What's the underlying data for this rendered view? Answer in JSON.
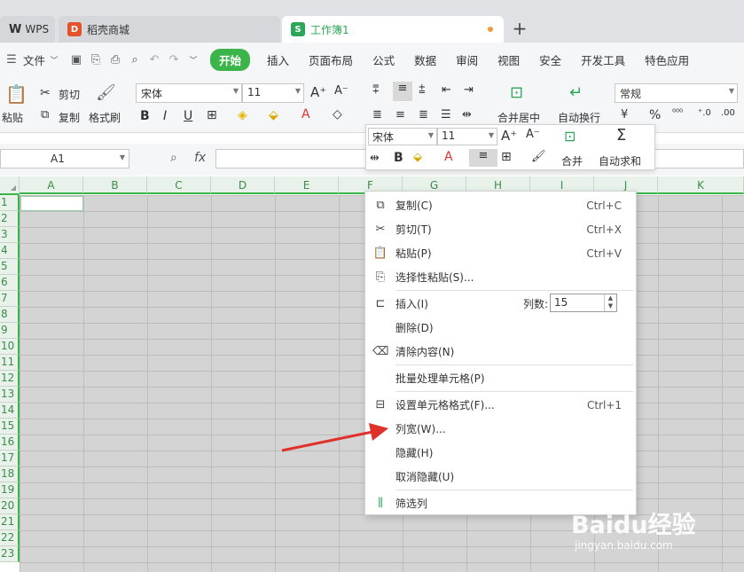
{
  "titlebar": {
    "wps_label": "WPS",
    "tab_shop": "稻壳商城",
    "tab_workbook": "工作簿1",
    "new_tab": "+"
  },
  "menu": {
    "file": "文件",
    "start": "开始",
    "insert": "插入",
    "page_layout": "页面布局",
    "formula": "公式",
    "data": "数据",
    "review": "审阅",
    "view": "视图",
    "security": "安全",
    "dev_tools": "开发工具",
    "special": "特色应用"
  },
  "ribbon": {
    "cut": "剪切",
    "copy": "复制",
    "paste": "粘贴",
    "format_painter": "格式刷",
    "font_name": "宋体",
    "font_size": "11",
    "merge_center": "合并居中",
    "wrap_text": "自动换行",
    "number_format": "常规"
  },
  "formula_bar": {
    "name_box": "A1",
    "fx": "fx"
  },
  "mini_toolbar": {
    "font_name": "宋体",
    "font_size": "11",
    "merge": "合并",
    "autosum": "自动求和"
  },
  "grid": {
    "columns": [
      "A",
      "B",
      "C",
      "D",
      "E",
      "F",
      "G",
      "H",
      "I",
      "J",
      "K"
    ],
    "rows": [
      "1",
      "2",
      "3",
      "4",
      "5",
      "6",
      "7",
      "8",
      "9",
      "10",
      "11",
      "12",
      "13",
      "14",
      "15",
      "16",
      "17",
      "18",
      "19",
      "20",
      "21",
      "22",
      "23"
    ]
  },
  "context_menu": {
    "copy": {
      "label": "复制(C)",
      "shortcut": "Ctrl+C"
    },
    "cut": {
      "label": "剪切(T)",
      "shortcut": "Ctrl+X"
    },
    "paste": {
      "label": "粘贴(P)",
      "shortcut": "Ctrl+V"
    },
    "paste_special": {
      "label": "选择性粘贴(S)..."
    },
    "insert": {
      "label": "插入(I)",
      "count_label": "列数:",
      "count_value": "15"
    },
    "delete": {
      "label": "删除(D)"
    },
    "clear": {
      "label": "清除内容(N)"
    },
    "batch": {
      "label": "批量处理单元格(P)"
    },
    "format_cells": {
      "label": "设置单元格格式(F)...",
      "shortcut": "Ctrl+1"
    },
    "col_width": {
      "label": "列宽(W)..."
    },
    "hide": {
      "label": "隐藏(H)"
    },
    "unhide": {
      "label": "取消隐藏(U)"
    },
    "filter": {
      "label": "筛选列"
    }
  },
  "watermark": {
    "logo": "Baidu经验",
    "url": "jingyan.baidu.com"
  },
  "colors": {
    "accent_green": "#3bb54a",
    "annotation_red": "#e0302a"
  }
}
